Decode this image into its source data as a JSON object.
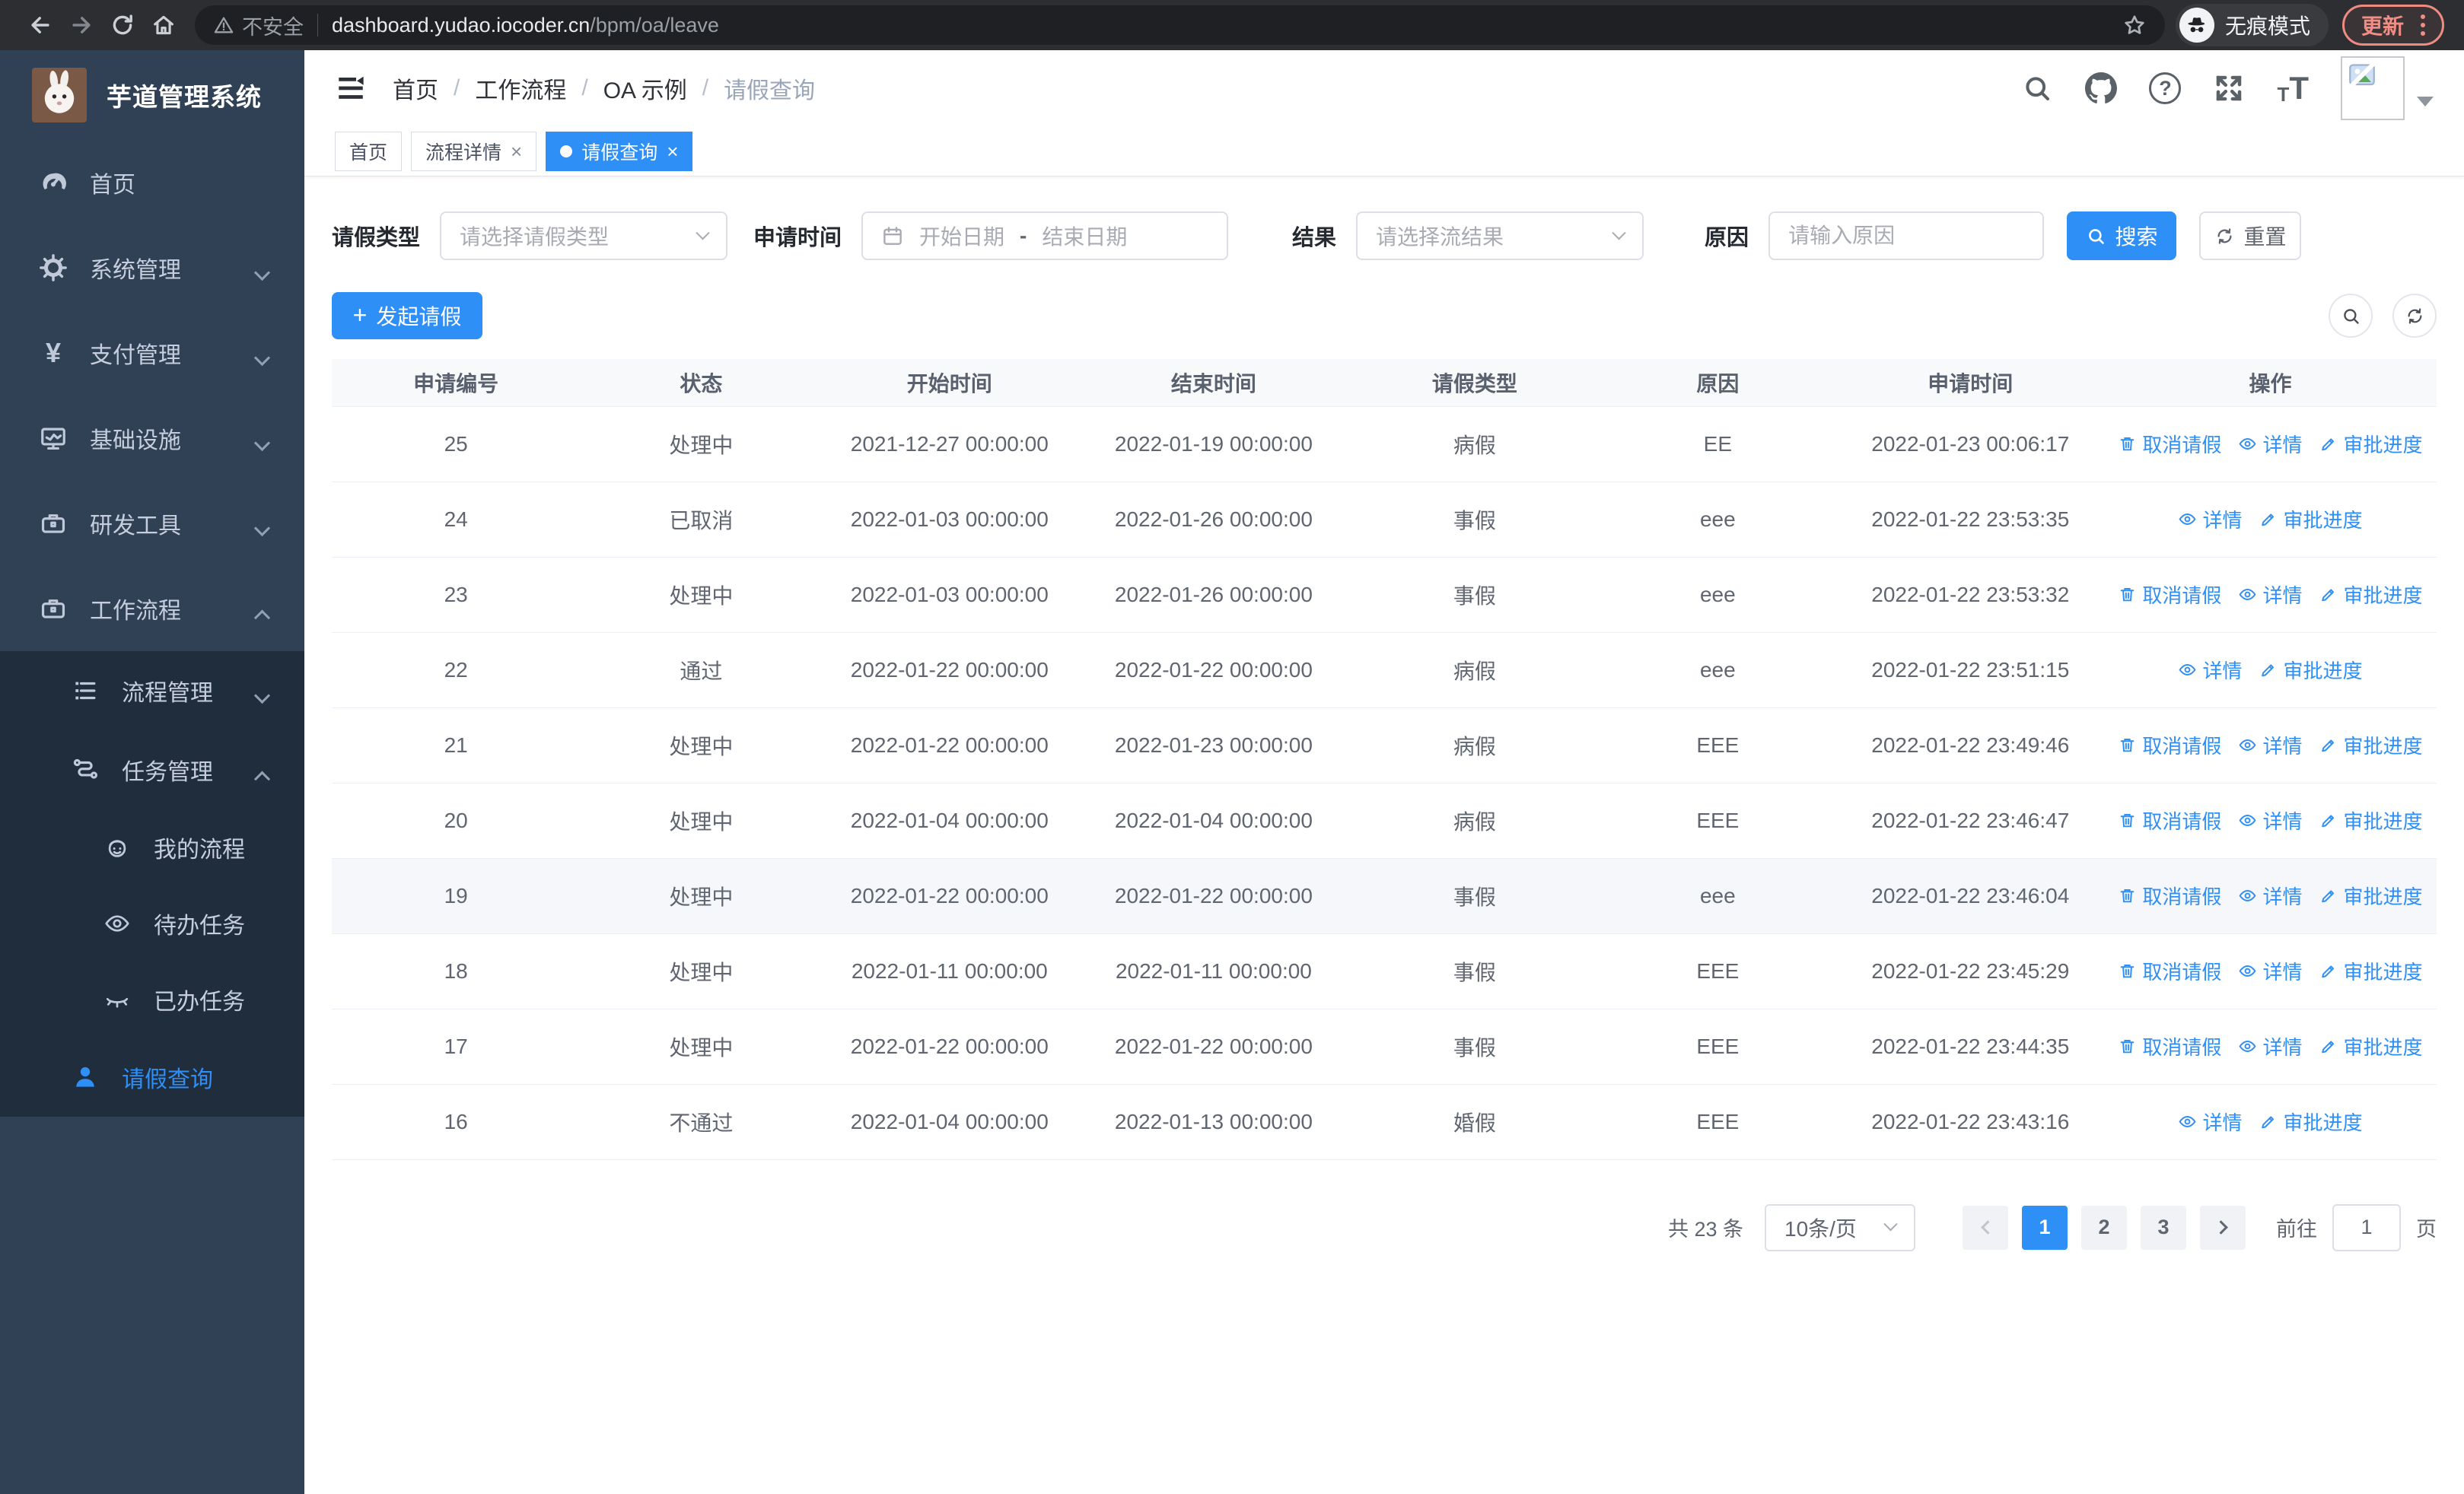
{
  "colors": {
    "primary": "#2e8ff7",
    "sidebar_bg": "#304156",
    "submenu_bg": "#1f2d3d",
    "chrome_bg": "#2d2e32"
  },
  "icons": {
    "plus": "+",
    "close": "×",
    "question": "?",
    "yen": "¥",
    "font_small": "T",
    "font_big": "T"
  },
  "browser": {
    "security_label": "不安全",
    "url_domain": "dashboard.yudao.iocoder.cn",
    "url_path": "/bpm/oa/leave",
    "incognito_label": "无痕模式",
    "update_label": "更新"
  },
  "sidebar": {
    "title": "芋道管理系统",
    "items": [
      {
        "label": "首页"
      },
      {
        "label": "系统管理"
      },
      {
        "label": "支付管理"
      },
      {
        "label": "基础设施"
      },
      {
        "label": "研发工具"
      },
      {
        "label": "工作流程"
      },
      {
        "label": "流程管理"
      },
      {
        "label": "任务管理"
      },
      {
        "label": "我的流程"
      },
      {
        "label": "待办任务"
      },
      {
        "label": "已办任务"
      },
      {
        "label": "请假查询"
      }
    ]
  },
  "navbar": {
    "breadcrumb": [
      {
        "label": "首页"
      },
      {
        "label": "工作流程"
      },
      {
        "label": "OA 示例"
      },
      {
        "label": "请假查询"
      }
    ]
  },
  "tags": [
    {
      "label": "首页"
    },
    {
      "label": "流程详情"
    },
    {
      "label": "请假查询"
    }
  ],
  "filters": {
    "leave_type_label": "请假类型",
    "leave_type_placeholder": "请选择请假类型",
    "apply_time_label": "申请时间",
    "start_date_placeholder": "开始日期",
    "range_separator": "-",
    "end_date_placeholder": "结束日期",
    "result_label": "结果",
    "result_placeholder": "请选择流结果",
    "reason_label": "原因",
    "reason_placeholder": "请输入原因",
    "search_button": "搜索",
    "reset_button": "重置"
  },
  "toolbar": {
    "create_button": "发起请假"
  },
  "table": {
    "columns": [
      "申请编号",
      "状态",
      "开始时间",
      "结束时间",
      "请假类型",
      "原因",
      "申请时间",
      "操作"
    ],
    "action_labels": {
      "cancel": "取消请假",
      "detail": "详情",
      "progress": "审批进度"
    },
    "rows": [
      {
        "id": "25",
        "status": "处理中",
        "start": "2021-12-27 00:00:00",
        "end": "2022-01-19 00:00:00",
        "type": "病假",
        "reason": "EE",
        "applied": "2022-01-23 00:06:17"
      },
      {
        "id": "24",
        "status": "已取消",
        "start": "2022-01-03 00:00:00",
        "end": "2022-01-26 00:00:00",
        "type": "事假",
        "reason": "eee",
        "applied": "2022-01-22 23:53:35"
      },
      {
        "id": "23",
        "status": "处理中",
        "start": "2022-01-03 00:00:00",
        "end": "2022-01-26 00:00:00",
        "type": "事假",
        "reason": "eee",
        "applied": "2022-01-22 23:53:32"
      },
      {
        "id": "22",
        "status": "通过",
        "start": "2022-01-22 00:00:00",
        "end": "2022-01-22 00:00:00",
        "type": "病假",
        "reason": "eee",
        "applied": "2022-01-22 23:51:15"
      },
      {
        "id": "21",
        "status": "处理中",
        "start": "2022-01-22 00:00:00",
        "end": "2022-01-23 00:00:00",
        "type": "病假",
        "reason": "EEE",
        "applied": "2022-01-22 23:49:46"
      },
      {
        "id": "20",
        "status": "处理中",
        "start": "2022-01-04 00:00:00",
        "end": "2022-01-04 00:00:00",
        "type": "病假",
        "reason": "EEE",
        "applied": "2022-01-22 23:46:47"
      },
      {
        "id": "19",
        "status": "处理中",
        "start": "2022-01-22 00:00:00",
        "end": "2022-01-22 00:00:00",
        "type": "事假",
        "reason": "eee",
        "applied": "2022-01-22 23:46:04"
      },
      {
        "id": "18",
        "status": "处理中",
        "start": "2022-01-11 00:00:00",
        "end": "2022-01-11 00:00:00",
        "type": "事假",
        "reason": "EEE",
        "applied": "2022-01-22 23:45:29"
      },
      {
        "id": "17",
        "status": "处理中",
        "start": "2022-01-22 00:00:00",
        "end": "2022-01-22 00:00:00",
        "type": "事假",
        "reason": "EEE",
        "applied": "2022-01-22 23:44:35"
      },
      {
        "id": "16",
        "status": "不通过",
        "start": "2022-01-04 00:00:00",
        "end": "2022-01-13 00:00:00",
        "type": "婚假",
        "reason": "EEE",
        "applied": "2022-01-22 23:43:16"
      }
    ]
  },
  "pagination": {
    "total": "共 23 条",
    "page_size": "10条/页",
    "pages": [
      "1",
      "2",
      "3"
    ],
    "current_page": "1",
    "goto_label": "前往",
    "goto_value": "1",
    "goto_unit": "页"
  }
}
